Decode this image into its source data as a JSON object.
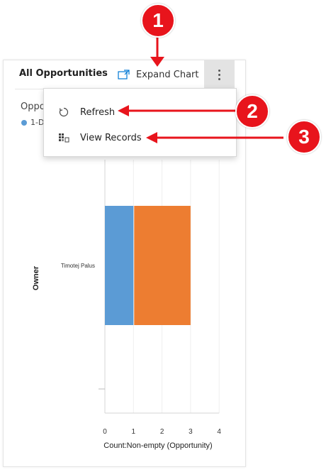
{
  "card": {
    "title": "All Opportunities",
    "expand_label": "Expand Chart",
    "chart_title": "Oppo",
    "legend_item": "1-D"
  },
  "menu": {
    "items": [
      {
        "label": "Refresh",
        "icon": "refresh-icon"
      },
      {
        "label": "View Records",
        "icon": "grid-records-icon"
      }
    ]
  },
  "annotations": [
    "1",
    "2",
    "3"
  ],
  "colors": {
    "accent_red": "#e8141c",
    "series_blue": "#5b9bd5",
    "series_orange": "#ed7d31",
    "link_blue": "#0078d4"
  },
  "chart_data": {
    "type": "bar",
    "orientation": "horizontal",
    "stacked": true,
    "categories": [
      "Timotej Palus"
    ],
    "series": [
      {
        "values": [
          1
        ],
        "color": "#5b9bd5"
      },
      {
        "values": [
          2
        ],
        "color": "#ed7d31"
      }
    ],
    "xlabel": "Count:Non-empty (Opportunity)",
    "ylabel": "Owner",
    "xlim": [
      0,
      4
    ],
    "xticks": [
      "0",
      "1",
      "2",
      "3",
      "4"
    ],
    "grid": true
  }
}
